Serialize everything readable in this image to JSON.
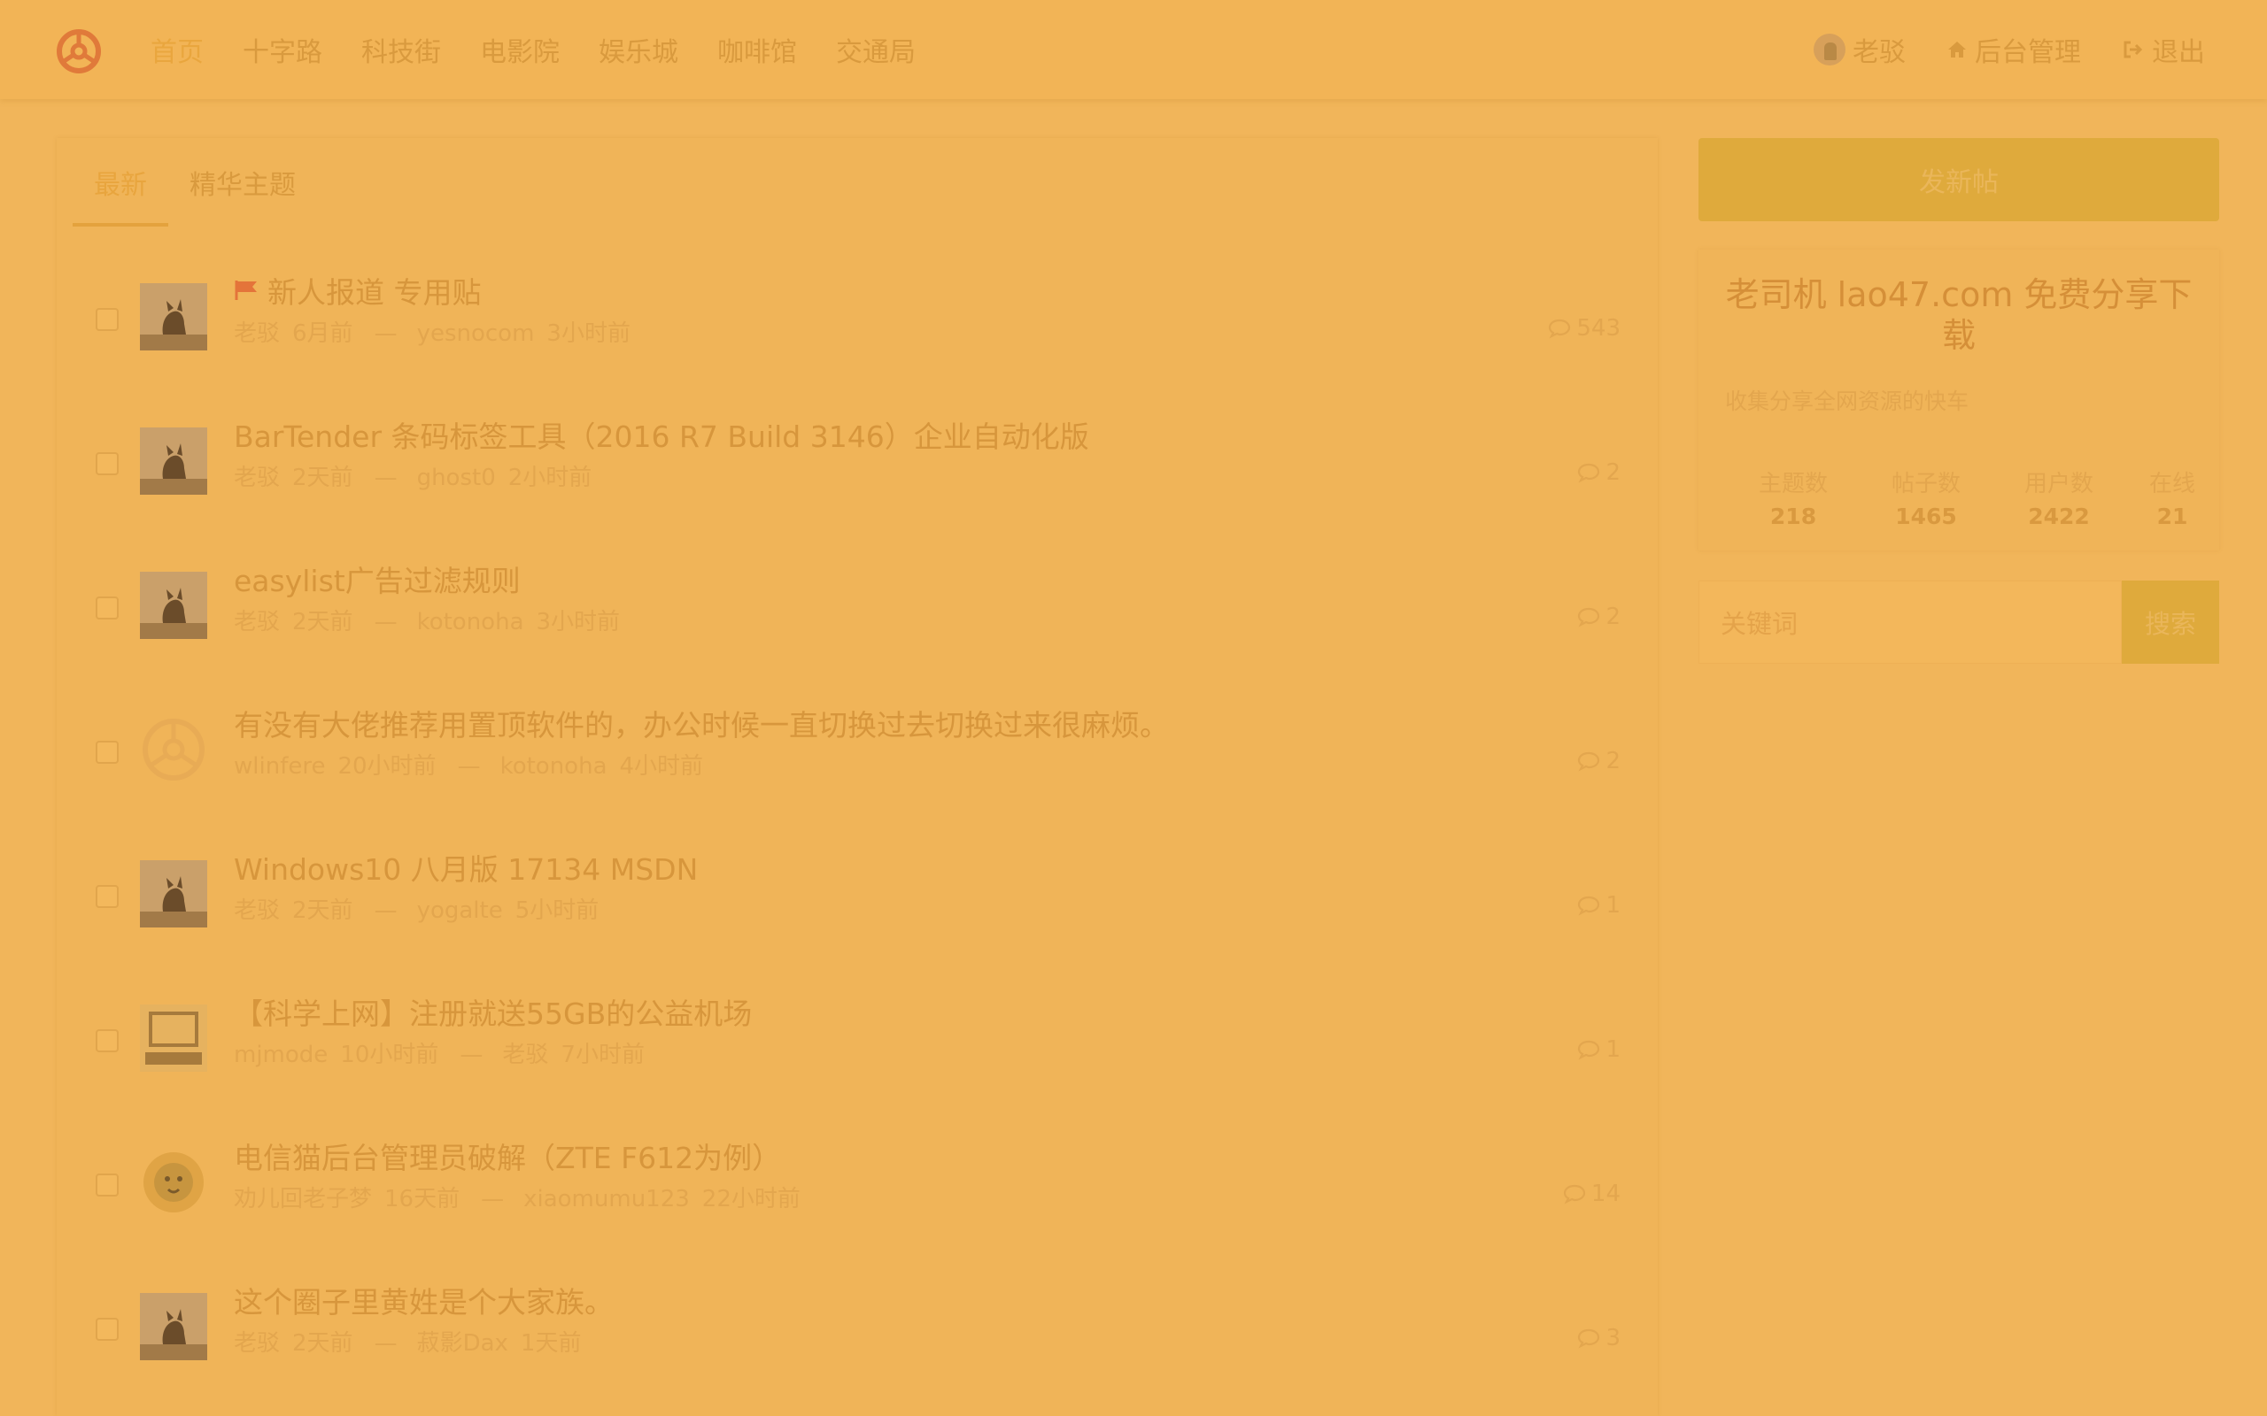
{
  "nav": {
    "links": [
      "首页",
      "十字路",
      "科技街",
      "电影院",
      "娱乐城",
      "咖啡馆",
      "交通局"
    ],
    "user": "老驳",
    "admin": "后台管理",
    "logout": "退出"
  },
  "tabs": [
    "最新",
    "精华主题"
  ],
  "threads": [
    {
      "title": "新人报道 专用贴",
      "flag": true,
      "author": "老驳",
      "author_time": "6月前",
      "replier": "yesnocom",
      "reply_time": "3小时前",
      "count": "543",
      "avatar": "fox"
    },
    {
      "title": "BarTender 条码标签工具（2016 R7 Build 3146）企业自动化版",
      "flag": false,
      "author": "老驳",
      "author_time": "2天前",
      "replier": "ghost0",
      "reply_time": "2小时前",
      "count": "2",
      "avatar": "fox"
    },
    {
      "title": "easylist广告过滤规则",
      "flag": false,
      "author": "老驳",
      "author_time": "2天前",
      "replier": "kotonoha",
      "reply_time": "3小时前",
      "count": "2",
      "avatar": "fox"
    },
    {
      "title": "有没有大佬推荐用置顶软件的，办公时候一直切换过去切换过来很麻烦。",
      "flag": false,
      "author": "wlinfere",
      "author_time": "20小时前",
      "replier": "kotonoha",
      "reply_time": "4小时前",
      "count": "2",
      "avatar": "wheel"
    },
    {
      "title": "Windows10 八月版 17134 MSDN",
      "flag": false,
      "author": "老驳",
      "author_time": "2天前",
      "replier": "yogalte",
      "reply_time": "5小时前",
      "count": "1",
      "avatar": "fox"
    },
    {
      "title": "【科学上网】注册就送55GB的公益机场",
      "flag": false,
      "author": "mjmode",
      "author_time": "10小时前",
      "replier": "老驳",
      "reply_time": "7小时前",
      "count": "1",
      "avatar": "box"
    },
    {
      "title": "电信猫后台管理员破解（ZTE F612为例）",
      "flag": false,
      "author": "劝儿回老子梦",
      "author_time": "16天前",
      "replier": "xiaomumu123",
      "reply_time": "22小时前",
      "count": "14",
      "avatar": "lion"
    },
    {
      "title": "这个圈子里黄姓是个大家族。",
      "flag": false,
      "author": "老驳",
      "author_time": "2天前",
      "replier": "菽影Dax",
      "reply_time": "1天前",
      "count": "3",
      "avatar": "fox"
    }
  ],
  "sidebar": {
    "new_post": "发新帖",
    "site_name": "老司机 lao47.com 免费分享下载",
    "site_desc": "收集分享全网资源的快车",
    "stats": [
      {
        "label": "主题数",
        "value": "218"
      },
      {
        "label": "帖子数",
        "value": "1465"
      },
      {
        "label": "用户数",
        "value": "2422"
      },
      {
        "label": "在线",
        "value": "21"
      }
    ],
    "search_placeholder": "关键词",
    "search_button": "搜索"
  }
}
